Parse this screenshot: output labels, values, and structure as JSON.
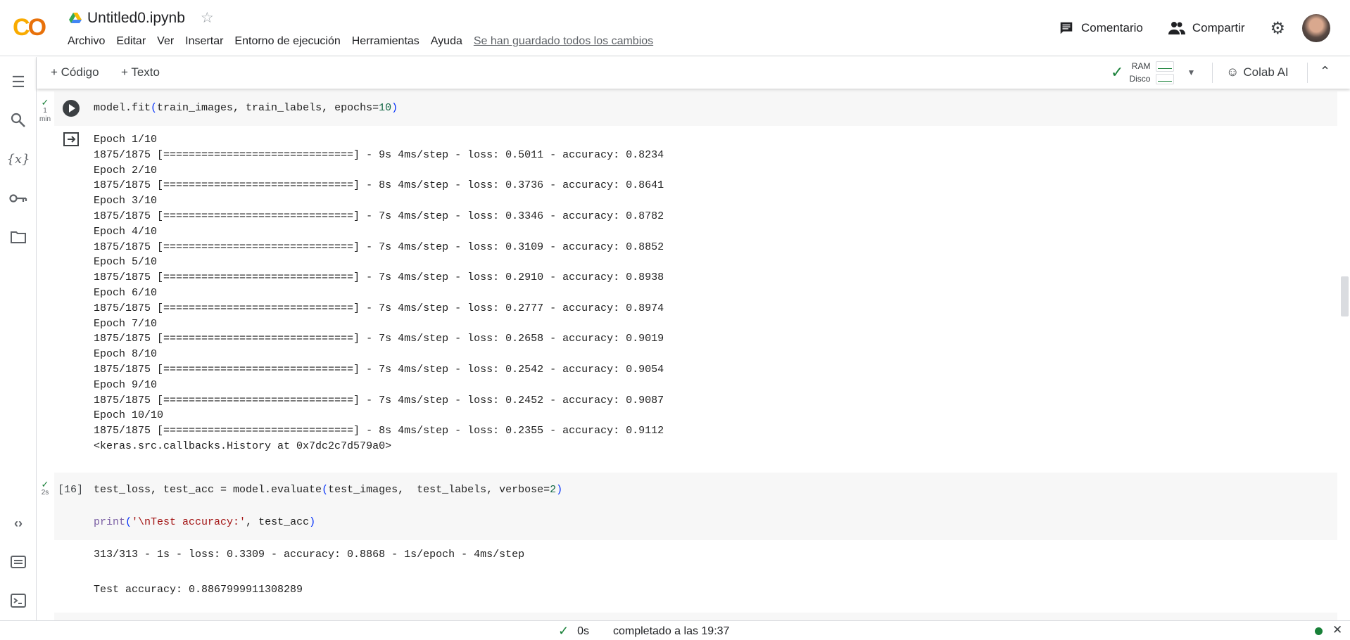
{
  "header": {
    "title": "Untitled0.ipynb",
    "menu": [
      "Archivo",
      "Editar",
      "Ver",
      "Insertar",
      "Entorno de ejecución",
      "Herramientas",
      "Ayuda"
    ],
    "saved_status": "Se han guardado todos los cambios",
    "comment_label": "Comentario",
    "share_label": "Compartir"
  },
  "toolbar": {
    "add_code": "+ Código",
    "add_text": "+ Texto",
    "ram_label": "RAM",
    "disk_label": "Disco",
    "colab_ai": "Colab AI"
  },
  "cells": [
    {
      "exec_time": "1",
      "exec_unit": "min",
      "code": "model.fit(train_images, train_labels, epochs=10)",
      "output": [
        "Epoch 1/10",
        "1875/1875 [==============================] - 9s 4ms/step - loss: 0.5011 - accuracy: 0.8234",
        "Epoch 2/10",
        "1875/1875 [==============================] - 8s 4ms/step - loss: 0.3736 - accuracy: 0.8641",
        "Epoch 3/10",
        "1875/1875 [==============================] - 7s 4ms/step - loss: 0.3346 - accuracy: 0.8782",
        "Epoch 4/10",
        "1875/1875 [==============================] - 7s 4ms/step - loss: 0.3109 - accuracy: 0.8852",
        "Epoch 5/10",
        "1875/1875 [==============================] - 7s 4ms/step - loss: 0.2910 - accuracy: 0.8938",
        "Epoch 6/10",
        "1875/1875 [==============================] - 7s 4ms/step - loss: 0.2777 - accuracy: 0.8974",
        "Epoch 7/10",
        "1875/1875 [==============================] - 7s 4ms/step - loss: 0.2658 - accuracy: 0.9019",
        "Epoch 8/10",
        "1875/1875 [==============================] - 7s 4ms/step - loss: 0.2542 - accuracy: 0.9054",
        "Epoch 9/10",
        "1875/1875 [==============================] - 7s 4ms/step - loss: 0.2452 - accuracy: 0.9087",
        "Epoch 10/10",
        "1875/1875 [==============================] - 8s 4ms/step - loss: 0.2355 - accuracy: 0.9112",
        "<keras.src.callbacks.History at 0x7dc2c7d579a0>"
      ]
    },
    {
      "exec_count": "[16]",
      "exec_time": "2s",
      "code_line1": "test_loss, test_acc = model.evaluate(test_images,  test_labels, verbose=2)",
      "code_line2": "print('\\nTest accuracy:', test_acc)",
      "output": [
        "313/313 - 1s - loss: 0.3309 - accuracy: 0.8868 - 1s/epoch - 4ms/step",
        "Test accuracy: 0.8867999911308289"
      ]
    }
  ],
  "status": {
    "duration": "0s",
    "message": "completado a las 19:37"
  },
  "colors": {
    "accent": "#f9ab00",
    "success": "#188038"
  }
}
